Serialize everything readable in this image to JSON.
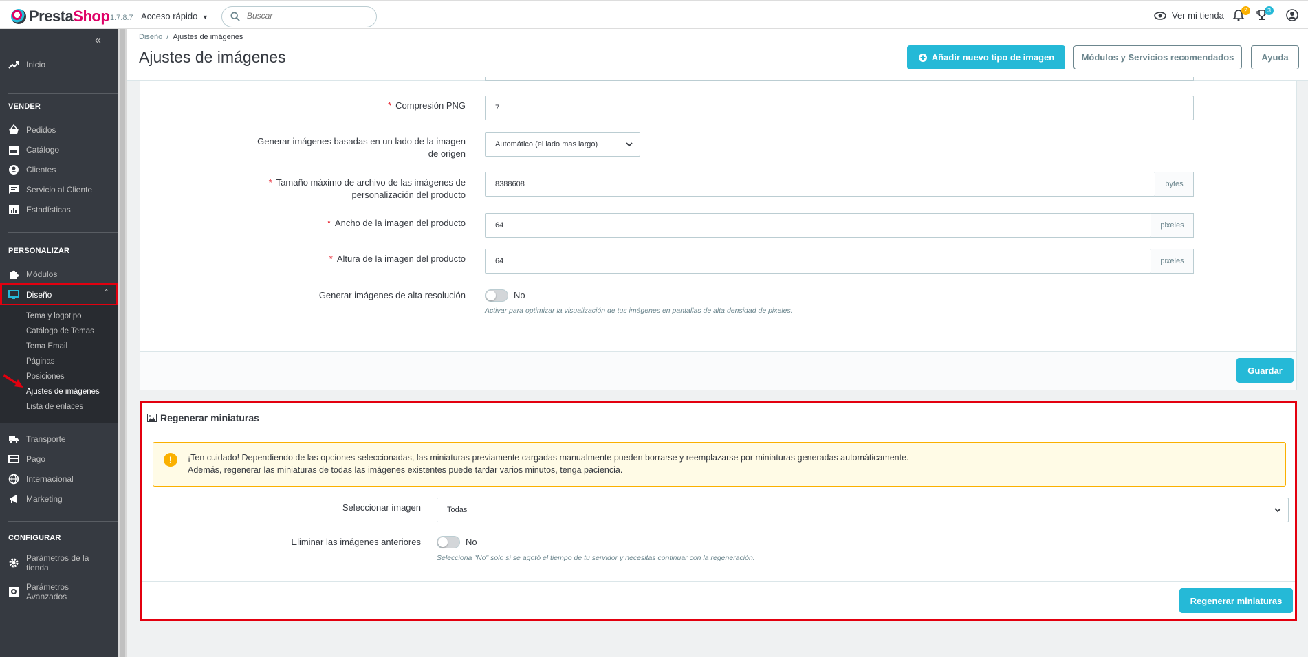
{
  "header": {
    "logo_prefix": "Presta",
    "logo_suffix": "Shop",
    "version": "1.7.8.7",
    "quick_access": "Acceso rápido",
    "search_placeholder": "Buscar",
    "view_shop": "Ver mi tienda",
    "notifications_count": "2",
    "trophy_count": "3",
    "colors": {
      "brand": "#df0067",
      "accent": "#25b9d7"
    }
  },
  "sidebar": {
    "home": "Inicio",
    "sections": {
      "sell": "VENDER",
      "customize": "PERSONALIZAR",
      "configure": "CONFIGURAR"
    },
    "sell_items": [
      "Pedidos",
      "Catálogo",
      "Clientes",
      "Servicio al Cliente",
      "Estadísticas"
    ],
    "customize_items": [
      "Módulos",
      "Diseño"
    ],
    "design_sub": [
      "Tema y logotipo",
      "Catálogo de Temas",
      "Tema Email",
      "Páginas",
      "Posiciones",
      "Ajustes de imágenes",
      "Lista de enlaces"
    ],
    "more_items": [
      "Transporte",
      "Pago",
      "Internacional",
      "Marketing"
    ],
    "config_items": [
      "Parámetros de la tienda",
      "Parámetros Avanzados"
    ],
    "config_item_1_line1": "Parámetros de la",
    "config_item_1_line2": "tienda",
    "config_item_2_line1": "Parámetros",
    "config_item_2_line2": "Avanzados"
  },
  "page": {
    "breadcrumb_parent": "Diseño",
    "breadcrumb_current": "Ajustes de imágenes",
    "title": "Ajustes de imágenes",
    "add_button": "Añadir nuevo tipo de imagen",
    "modules_button": "Módulos y Servicios recomendados",
    "help_button": "Ayuda"
  },
  "form": {
    "png_label": "Compresión PNG",
    "png_value": "7",
    "gen_label_line1": "Generar imágenes basadas en un lado de la imagen",
    "gen_label_line2": "de origen",
    "gen_value": "Automático (el lado mas largo)",
    "maxsize_label_line1": "Tamaño máximo de archivo de las imágenes de",
    "maxsize_label_line2": "personalización del producto",
    "maxsize_value": "8388608",
    "maxsize_unit": "bytes",
    "width_label": "Ancho de la imagen del producto",
    "width_value": "64",
    "width_unit": "pixeles",
    "height_label": "Altura de la imagen del producto",
    "height_value": "64",
    "height_unit": "pixeles",
    "hires_label": "Generar imágenes de alta resolución",
    "hires_value": "No",
    "hires_help": "Activar para optimizar la visualización de tus imágenes en pantallas de alta densidad de pixeles.",
    "save_button": "Guardar"
  },
  "regenerate": {
    "title": "Regenerar miniaturas",
    "alert_line1": "¡Ten cuidado! Dependiendo de las opciones seleccionadas, las miniaturas previamente cargadas manualmente pueden borrarse y reemplazarse por miniaturas generadas automáticamente.",
    "alert_line2": "Además, regenerar las miniaturas de todas las imágenes existentes puede tardar varios minutos, tenga paciencia.",
    "select_label": "Seleccionar imagen",
    "select_value": "Todas",
    "delete_label": "Eliminar las imágenes anteriores",
    "delete_value": "No",
    "delete_help": "Selecciona \"No\" solo si se agotó el tiempo de tu servidor y necesitas continuar con la regeneración.",
    "button": "Regenerar miniaturas"
  }
}
